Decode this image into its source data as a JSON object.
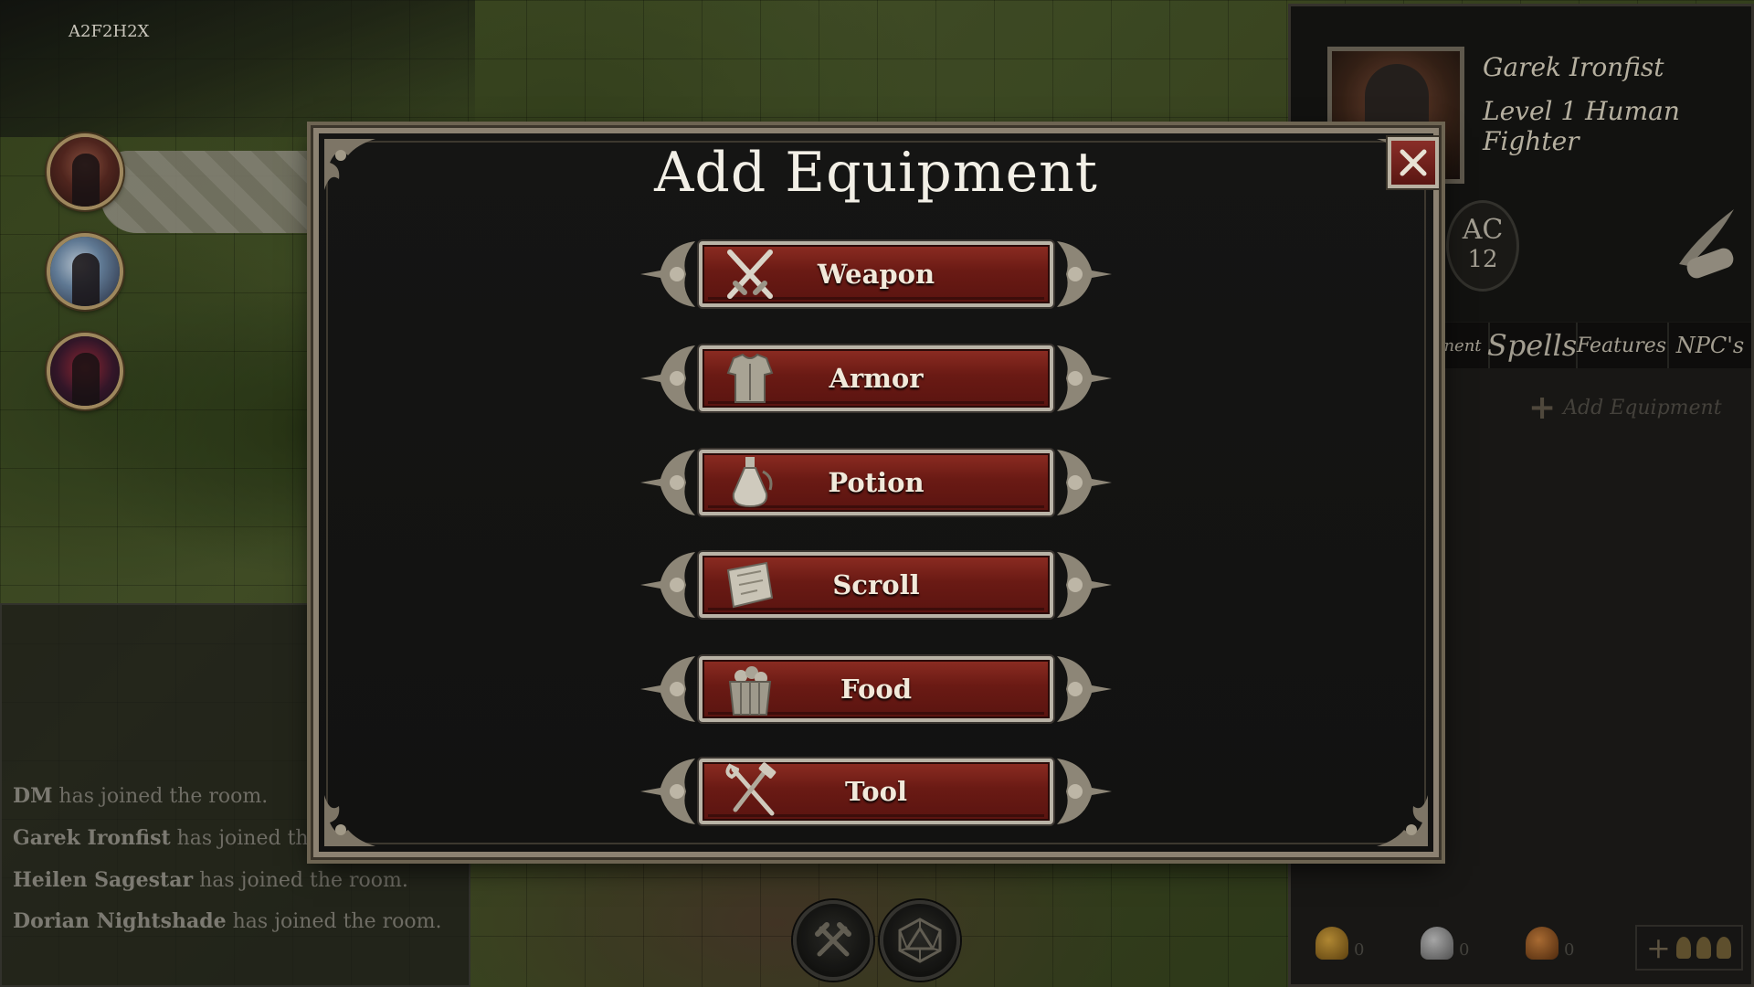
{
  "room": {
    "code": "A2F2H2X"
  },
  "party": [
    {
      "name": "Garek Ironfist"
    },
    {
      "name": "Heilen Sagestar"
    },
    {
      "name": "Dorian Nightshade"
    }
  ],
  "chat": {
    "messages": [
      {
        "user": "DM",
        "text": " has joined the room."
      },
      {
        "user": "Garek Ironfist",
        "text": " has joined the room."
      },
      {
        "user": "Heilen Sagestar",
        "text": " has joined the room."
      },
      {
        "user": "Dorian Nightshade",
        "text": " has joined the room."
      }
    ]
  },
  "character": {
    "name": "Garek Ironfist",
    "subtitle": "Level 1 Human Fighter",
    "ac_label": "AC",
    "ac_value": "12"
  },
  "sheet_tabs": {
    "equipment": "nent",
    "spells": "Spells",
    "features": "Features",
    "npcs": "NPC's"
  },
  "sheet": {
    "add_equipment_label": "Add Equipment"
  },
  "coins": {
    "gold": "0",
    "silver": "0",
    "copper": "0"
  },
  "modal": {
    "title": "Add Equipment",
    "options": [
      {
        "label": "Weapon",
        "icon": "crossed-swords-icon"
      },
      {
        "label": "Armor",
        "icon": "chestplate-icon"
      },
      {
        "label": "Potion",
        "icon": "potion-flask-icon"
      },
      {
        "label": "Scroll",
        "icon": "scroll-icon"
      },
      {
        "label": "Food",
        "icon": "food-crate-icon"
      },
      {
        "label": "Tool",
        "icon": "hammer-wrench-icon"
      }
    ]
  },
  "colors": {
    "button_red": "#7a2018",
    "frame_silver": "#b9b3a6",
    "modal_bg": "#141413",
    "text_light": "#f1e9da"
  }
}
